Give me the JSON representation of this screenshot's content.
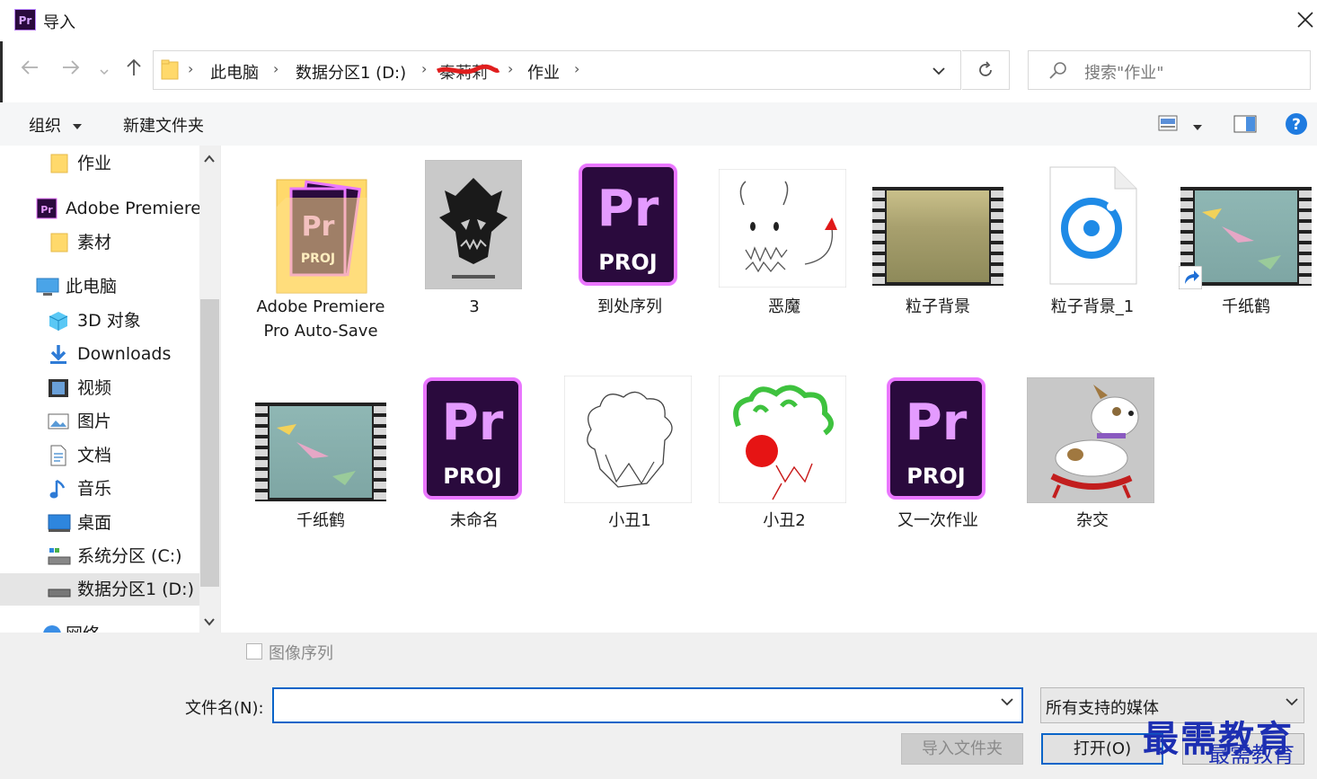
{
  "window": {
    "title": "导入",
    "app_icon": "Pr"
  },
  "address": {
    "crumbs": [
      "此电脑",
      "数据分区1 (D:)",
      "作业"
    ],
    "redacted_label": "秦莉莉"
  },
  "search": {
    "placeholder": "搜索\"作业\""
  },
  "toolbar": {
    "organize": "组织",
    "new_folder": "新建文件夹"
  },
  "sidebar": {
    "items": [
      {
        "label": "作业",
        "icon": "folder-icon"
      },
      {
        "label": "Adobe Premiere",
        "icon": "premiere-icon"
      },
      {
        "label": "素材",
        "icon": "folder-icon"
      },
      {
        "label": "此电脑",
        "icon": "computer-icon"
      },
      {
        "label": "3D 对象",
        "icon": "cube-icon"
      },
      {
        "label": "Downloads",
        "icon": "download-icon"
      },
      {
        "label": "视频",
        "icon": "video-icon"
      },
      {
        "label": "图片",
        "icon": "picture-icon"
      },
      {
        "label": "文档",
        "icon": "document-icon"
      },
      {
        "label": "音乐",
        "icon": "music-icon"
      },
      {
        "label": "桌面",
        "icon": "desktop-icon"
      },
      {
        "label": "系统分区 (C:)",
        "icon": "drive-icon"
      },
      {
        "label": "数据分区1 (D:)",
        "icon": "drive-icon"
      },
      {
        "label": "网络",
        "icon": "network-icon"
      }
    ]
  },
  "files": [
    {
      "name": "Adobe Premiere Pro Auto-Save",
      "kind": "folder"
    },
    {
      "name": "3",
      "kind": "image"
    },
    {
      "name": "到处序列",
      "kind": "project"
    },
    {
      "name": "恶魔",
      "kind": "image"
    },
    {
      "name": "粒子背景",
      "kind": "video"
    },
    {
      "name": "粒子背景_1",
      "kind": "media"
    },
    {
      "name": "千纸鹤",
      "kind": "video-shortcut"
    },
    {
      "name": "千纸鹤",
      "kind": "video"
    },
    {
      "name": "未命名",
      "kind": "project"
    },
    {
      "name": "小丑1",
      "kind": "image"
    },
    {
      "name": "小丑2",
      "kind": "image"
    },
    {
      "name": "又一次作业",
      "kind": "project"
    },
    {
      "name": "杂交",
      "kind": "image"
    }
  ],
  "project_tile": {
    "badge": "Pr",
    "subtitle": "PROJ"
  },
  "bottom": {
    "image_sequence": "图像序列",
    "filename_label": "文件名(N):",
    "filename_value": "",
    "file_type": "所有支持的媒体",
    "import_folder": "导入文件夹",
    "open": "打开(O)",
    "watermark": "最需教育",
    "watermark_small": "最需教育"
  },
  "colors": {
    "accent": "#0a64c8",
    "premiere_bg": "#2a0a3d",
    "premiere_border": "#ea77ff",
    "folder": "#ffd96b"
  }
}
